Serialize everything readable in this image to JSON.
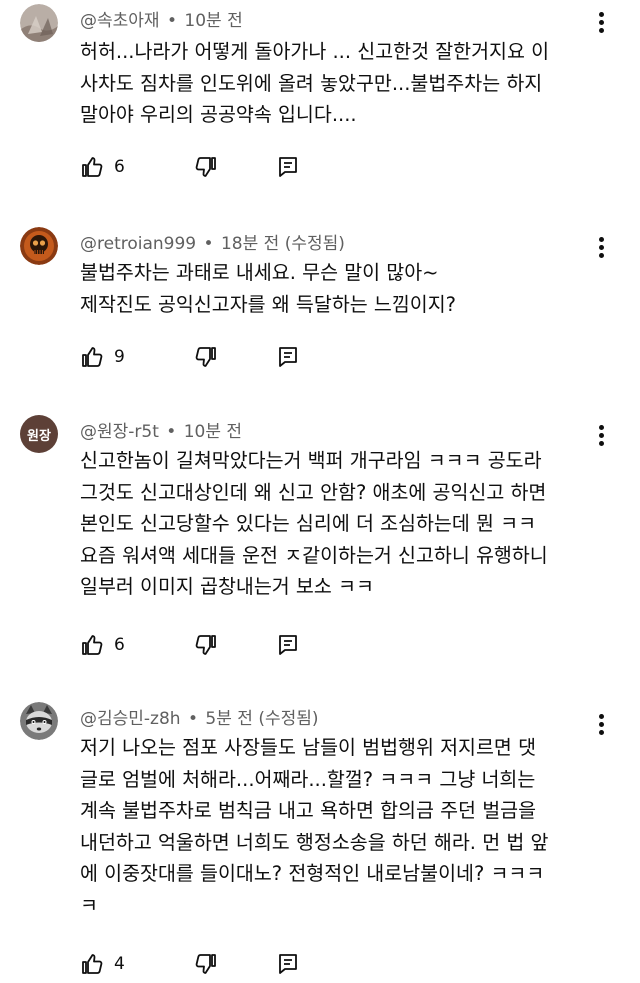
{
  "comments": [
    {
      "author": "@속초아재",
      "time": "10분 전",
      "edited": "",
      "lines": [
        "허허...나라가 어떻게 돌아가나 ... 신고한것 잘한거지요 이",
        "사차도 짐차를 인도위에 올려 놓았구만...불법주차는 하지",
        "말아야 우리의 공공약속 입니다...."
      ],
      "likes": "6",
      "avatar": {
        "icon": "photo-avatar",
        "color": "#b9aea6",
        "text": ""
      }
    },
    {
      "author": "@retroian999",
      "time": "18분 전",
      "edited": "(수정됨)",
      "lines": [
        "불법주차는 과태로 내세요. 무슨 말이 많아~",
        "제작진도 공익신고자를 왜 득달하는 느낌이지?"
      ],
      "likes": "9",
      "avatar": {
        "icon": "skull-avatar",
        "color": "#8a3a12",
        "text": ""
      }
    },
    {
      "author": "@원장-r5t",
      "time": "10분 전",
      "edited": "",
      "lines": [
        "신고한놈이 길쳐막았다는거 백퍼 개구라임 ㅋㅋㅋ 공도라",
        "그것도 신고대상인데 왜 신고 안함? 애초에 공익신고 하면",
        "본인도 신고당할수 있다는 심리에 더 조심하는데 뭔 ㅋㅋ",
        "요즘 워셔액 세대들 운전 ㅈ같이하는거 신고하니 유행하니",
        "일부러 이미지 곱창내는거 보소 ㅋㅋ"
      ],
      "likes": "6",
      "avatar": {
        "icon": "text-avatar",
        "color": "#5d4037",
        "text": "원장"
      }
    },
    {
      "author": "@김승민-z8h",
      "time": "5분 전",
      "edited": "(수정됨)",
      "lines": [
        "저기 나오는 점포 사장들도 남들이 범법행위 저지르면 댓",
        "글로 엄벌에 처해라...어째라...할껄? ㅋㅋㅋ 그냥  너희는",
        "계속 불법주차로 범칙금 내고 욕하면 합의금 주던 벌금을",
        "내던하고 억울하면 너희도 행정소송을 하던 해라. 먼 법 앞",
        "에 이중잣대를 들이대노? 전형적인 내로남불이네? ㅋㅋㅋ",
        "ㅋ"
      ],
      "likes": "4",
      "avatar": {
        "icon": "raccoon-avatar",
        "color": "#6b6b6b",
        "text": ""
      }
    }
  ],
  "icons": {
    "like": "thumbs-up-icon",
    "dislike": "thumbs-down-icon",
    "reply": "reply-icon",
    "more": "more-vert-icon"
  }
}
